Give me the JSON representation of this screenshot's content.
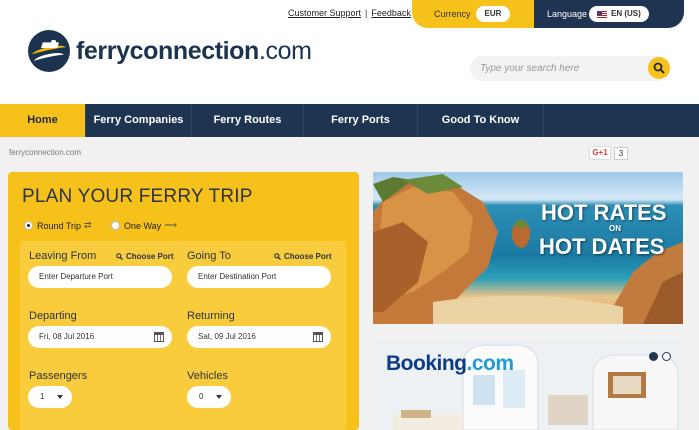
{
  "header": {
    "logo": {
      "brand_bold": "ferryconnection",
      "brand_suffix": ".com"
    },
    "links": {
      "support": "Customer Support",
      "separator": "|",
      "feedback": "Feedback"
    },
    "currency": {
      "label": "Currency",
      "value": "EUR"
    },
    "language": {
      "label": "Language",
      "value": "EN (US)"
    },
    "search": {
      "placeholder": "Type your search here"
    }
  },
  "nav": {
    "items": [
      {
        "label": "Home",
        "active": true
      },
      {
        "label": "Ferry Companies",
        "active": false
      },
      {
        "label": "Ferry Routes",
        "active": false
      },
      {
        "label": "Ferry Ports",
        "active": false
      },
      {
        "label": "Good To Know",
        "active": false
      }
    ]
  },
  "breadcrumb": "ferryconnection.com",
  "social": {
    "gplus_label": "G+1",
    "gplus_count": "3"
  },
  "booking": {
    "title": "PLAN YOUR FERRY TRIP",
    "trip_types": [
      {
        "label": "Round Trip",
        "selected": true
      },
      {
        "label": "One Way",
        "selected": false
      }
    ],
    "leaving": {
      "label": "Leaving From",
      "choose": "Choose Port",
      "placeholder": "Enter Departure Port"
    },
    "going": {
      "label": "Going To",
      "choose": "Choose Port",
      "placeholder": "Enter Destination Port"
    },
    "departing": {
      "label": "Departing",
      "value": "Fri, 08 Jul 2016"
    },
    "returning": {
      "label": "Returning",
      "value": "Sat, 09 Jul 2016"
    },
    "passengers": {
      "label": "Passengers",
      "value": "1"
    },
    "vehicles": {
      "label": "Vehicles",
      "value": "0"
    }
  },
  "promos": {
    "hot": {
      "line1": "HOT RATES",
      "connector": "ON",
      "line2": "HOT DATES"
    },
    "booking": {
      "brand": "Booking",
      "suffix": ".com"
    }
  },
  "colors": {
    "accent": "#f7c11c",
    "navy": "#1f3450"
  }
}
